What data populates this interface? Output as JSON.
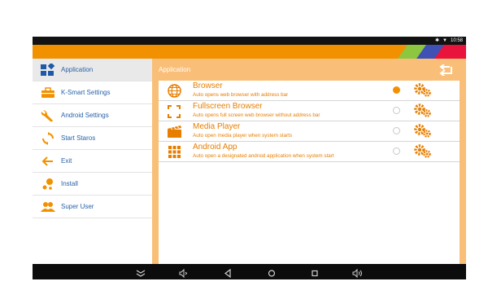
{
  "statusbar": {
    "bluetooth_icon": "bluetooth-icon",
    "wifi_icon": "wifi-icon",
    "time": "10:58"
  },
  "colors": {
    "accent": "#f29100",
    "panel": "#f9bf78",
    "sidebar_text": "#2a62a8",
    "item_text": "#e77e00"
  },
  "sidebar": {
    "items": [
      {
        "label": "Application",
        "icon": "apps-icon",
        "active": true
      },
      {
        "label": "K-Smart Settings",
        "icon": "toolbox-icon",
        "active": false
      },
      {
        "label": "Android Settings",
        "icon": "wrench-icon",
        "active": false
      },
      {
        "label": "Start Staros",
        "icon": "refresh-icon",
        "active": false
      },
      {
        "label": "Exit",
        "icon": "arrow-left-icon",
        "active": false
      },
      {
        "label": "Install",
        "icon": "install-icon",
        "active": false
      },
      {
        "label": "Super User",
        "icon": "users-icon",
        "active": false
      }
    ]
  },
  "main": {
    "title": "Application",
    "back_icon": "back-arrow-icon",
    "rows": [
      {
        "title": "Browser",
        "desc": "Auto opens web browser with address bar",
        "icon": "globe-icon",
        "selected": true
      },
      {
        "title": "Fullscreen Browser",
        "desc": "Auto opens full screen web browser without address bar",
        "icon": "fullscreen-icon",
        "selected": false
      },
      {
        "title": "Media Player",
        "desc": "Auto open media player when system starts",
        "icon": "clapperboard-icon",
        "selected": false
      },
      {
        "title": "Android App",
        "desc": "Auto open a designated android application when system start",
        "icon": "grid-icon",
        "selected": false
      }
    ]
  },
  "navbar": {
    "icons": [
      "collapse-icon",
      "volume-down-icon",
      "back-icon",
      "home-icon",
      "recents-icon",
      "volume-up-icon"
    ]
  }
}
